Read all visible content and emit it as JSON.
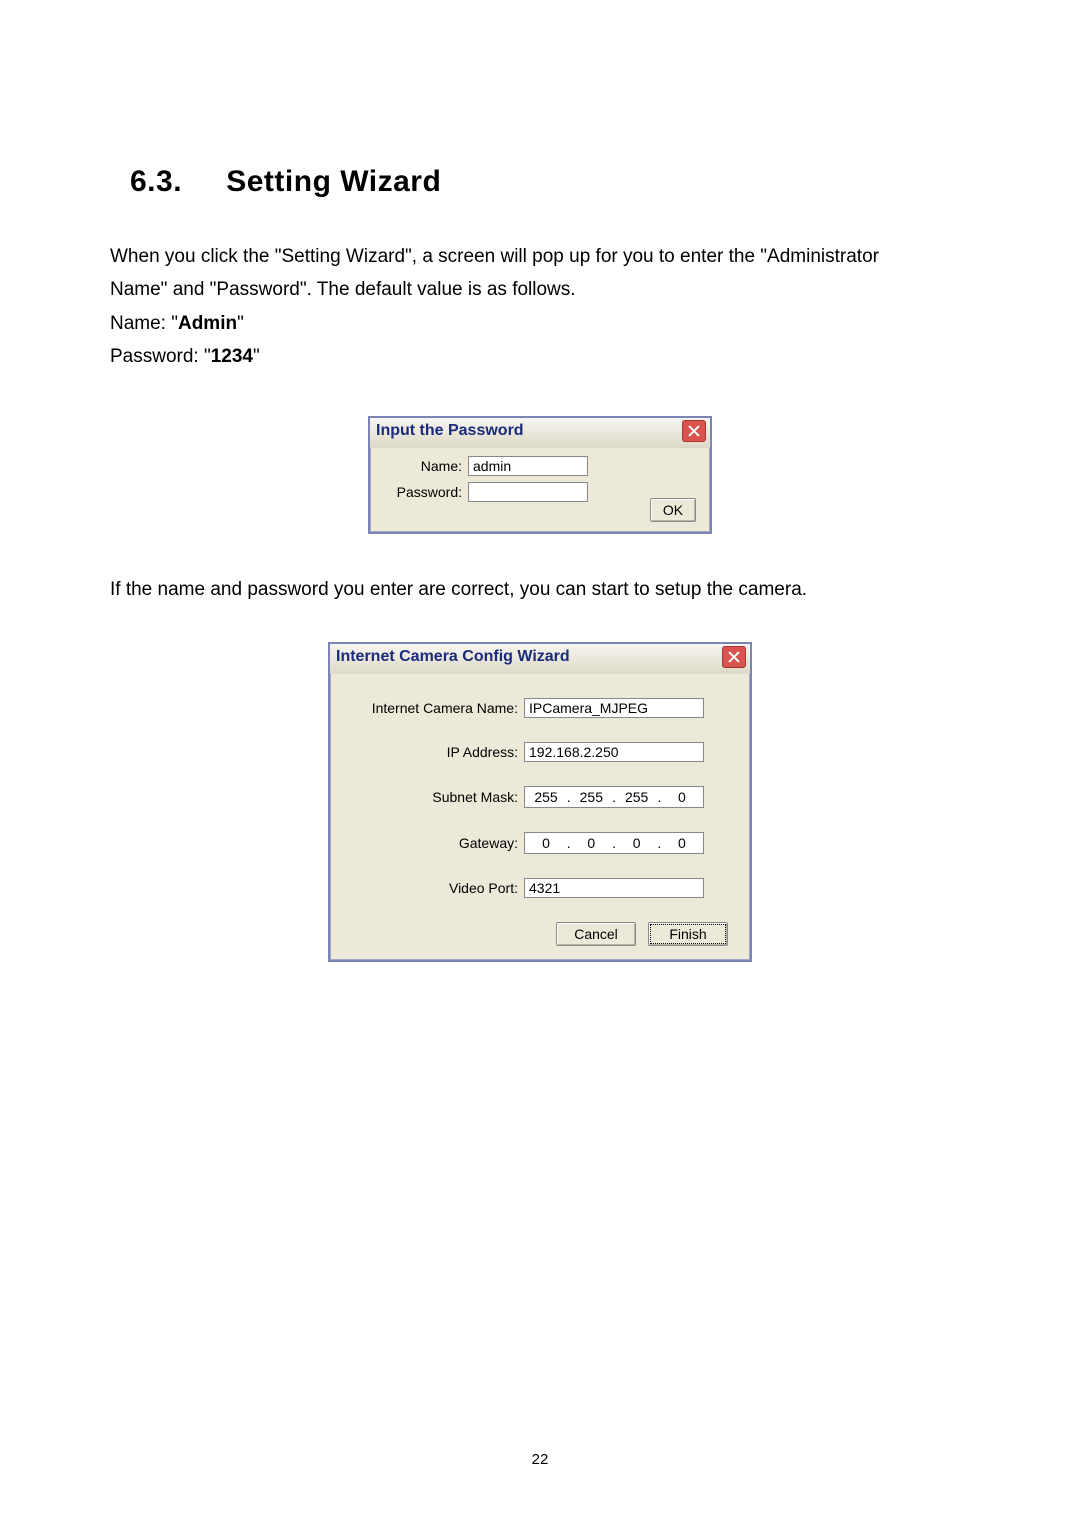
{
  "heading": {
    "number": "6.3.",
    "title": "Setting Wizard"
  },
  "intro": {
    "line1_a": "When you click the \"Setting Wizard\", a screen will pop up for you to enter the \"Administrator",
    "line1_b": "Name\" and \"Password\". The default value is as follows.",
    "name_label": "Name: \"",
    "name_value": "Admin",
    "name_close": "\"",
    "pwd_label": "Password: \"",
    "pwd_value": "1234",
    "pwd_close": "\""
  },
  "dlg1": {
    "title": "Input the Password",
    "name_label": "Name:",
    "name_value": "admin",
    "pwd_label": "Password:",
    "pwd_value": "",
    "ok_label": "OK"
  },
  "mid_text": "If the name and password you enter are correct, you can start to setup the camera.",
  "dlg2": {
    "title": "Internet Camera Config Wizard",
    "rows": {
      "camname_label": "Internet Camera Name:",
      "camname_value": "IPCamera_MJPEG",
      "ip_label": "IP Address:",
      "ip_value": "192.168.2.250",
      "subnet_label": "Subnet Mask:",
      "subnet_octets": [
        "255",
        "255",
        "255",
        "0"
      ],
      "gateway_label": "Gateway:",
      "gateway_octets": [
        "0",
        "0",
        "0",
        "0"
      ],
      "port_label": "Video Port:",
      "port_value": "4321"
    },
    "cancel_label": "Cancel",
    "finish_label": "Finish"
  },
  "page_number": "22"
}
